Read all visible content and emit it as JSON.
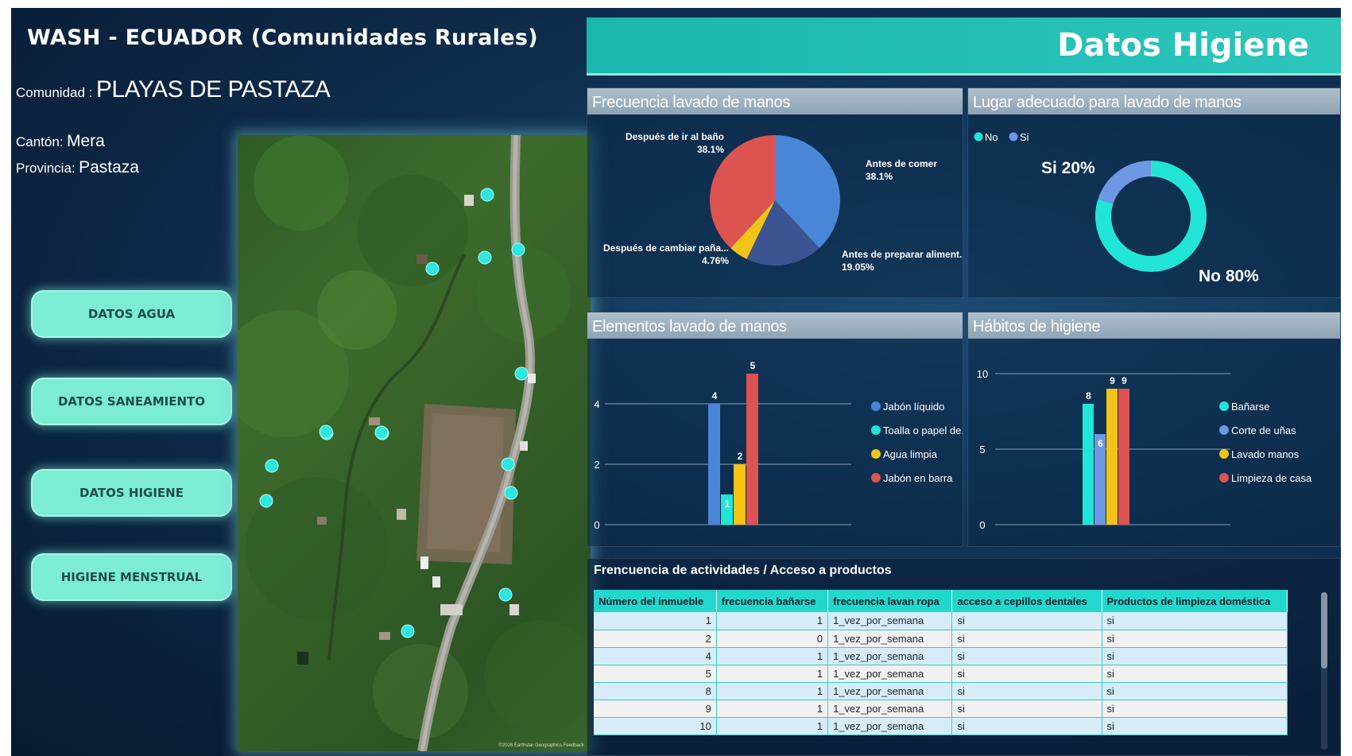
{
  "app": {
    "title": "WASH - ECUADOR (Comunidades Rurales)",
    "community_label": "Comunidad :",
    "community_value": "PLAYAS DE PASTAZA",
    "canton_label": "Cantón:",
    "canton_value": "Mera",
    "province_label": "Provincia:",
    "province_value": "Pastaza"
  },
  "nav": {
    "agua": "DATOS AGUA",
    "saneamiento": "DATOS SANEAMIENTO",
    "higiene": "DATOS HIGIENE",
    "menstrual": "HIGIENE MENSTRUAL"
  },
  "map": {
    "credit": "©2026 Earthstar Geographics  Feedback",
    "marker_color": "#2ee6e0",
    "marker_count": 15
  },
  "header": {
    "title": "Datos Higiene",
    "color": "#19b7ad"
  },
  "colors": {
    "teal": "#21e6d7",
    "blue": "#4a86d8",
    "light_blue": "#6e98e4",
    "navy": "#3c5491",
    "yellow": "#f2c418",
    "red": "#dc5350",
    "header_bg": "#22d8cc"
  },
  "panels": {
    "freq_lavado": "Frecuencia lavado de manos",
    "lugar_adecuado": "Lugar adecuado para lavado de manos",
    "elementos": "Elementos lavado de manos",
    "habitos": "Hábitos de higiene"
  },
  "chart_data": [
    {
      "type": "pie",
      "title": "Frecuencia lavado de manos",
      "slices": [
        {
          "label": "Antes de comer",
          "pct_label": "38.1%",
          "value": 38.1,
          "color": "#4a86d8"
        },
        {
          "label": "Antes de preparar aliment...",
          "pct_label": "19.05%",
          "value": 19.05,
          "color": "#3c5491"
        },
        {
          "label": "Después de cambiar paña...",
          "pct_label": "4.76%",
          "value": 4.76,
          "color": "#f2c418"
        },
        {
          "label": "Después de ir al baño",
          "pct_label": "38.1%",
          "value": 38.1,
          "color": "#dc5350"
        }
      ]
    },
    {
      "type": "pie",
      "title": "Lugar adecuado para lavado de manos",
      "legend": [
        "No",
        "Si"
      ],
      "legend_position": "top-left",
      "slices": [
        {
          "label": "No",
          "text": "No 80%",
          "value": 80,
          "color": "#21e6d7"
        },
        {
          "label": "Si",
          "text": "Si 20%",
          "value": 20,
          "color": "#6e98e4"
        }
      ]
    },
    {
      "type": "bar",
      "title": "Elementos lavado de manos",
      "ylim": [
        0,
        5
      ],
      "yticks": [
        "0",
        "2",
        "4"
      ],
      "ytick_values": [
        0,
        2,
        4
      ],
      "grid": true,
      "legend_position": "right",
      "series": [
        {
          "name": "Jabón líquido",
          "value": 4,
          "label": "4",
          "color": "#4a86d8"
        },
        {
          "name": "Toalla o papel de...",
          "value": 1,
          "label": "1",
          "color": "#21e6d7"
        },
        {
          "name": "Agua limpia",
          "value": 2,
          "label": "2",
          "color": "#f2c418"
        },
        {
          "name": "Jabón en barra",
          "value": 5,
          "label": "5",
          "color": "#dc5350"
        }
      ]
    },
    {
      "type": "bar",
      "title": "Hábitos de higiene",
      "ylim": [
        0,
        10
      ],
      "yticks": [
        "0",
        "5",
        "10"
      ],
      "ytick_values": [
        0,
        5,
        10
      ],
      "grid": true,
      "legend_position": "right",
      "series": [
        {
          "name": "Bañarse",
          "value": 8,
          "label": "8",
          "color": "#21e6d7"
        },
        {
          "name": "Corte de uñas",
          "value": 6,
          "label": "6",
          "color": "#6e98e4"
        },
        {
          "name": "Lavado manos",
          "value": 9,
          "label": "9",
          "color": "#f2c418"
        },
        {
          "name": "Limpieza de casa",
          "value": 9,
          "label": "9",
          "color": "#dc5350"
        }
      ]
    }
  ],
  "table": {
    "title": "Frencuencia de actividades / Acceso a productos",
    "headers": [
      "Número del inmueble",
      "frecuencia bañarse",
      "frecuencia lavan ropa",
      "acceso a cepillos dentales",
      "Productos de limpieza doméstica"
    ],
    "rows": [
      [
        "1",
        "1",
        "1_vez_por_semana",
        "si",
        "si"
      ],
      [
        "2",
        "0",
        "1_vez_por_semana",
        "si",
        "si"
      ],
      [
        "4",
        "1",
        "1_vez_por_semana",
        "si",
        "si"
      ],
      [
        "5",
        "1",
        "1_vez_por_semana",
        "si",
        "si"
      ],
      [
        "8",
        "1",
        "1_vez_por_semana",
        "si",
        "si"
      ],
      [
        "9",
        "1",
        "1_vez_por_semana",
        "si",
        "si"
      ],
      [
        "10",
        "1",
        "1_vez_por_semana",
        "si",
        "si"
      ]
    ]
  }
}
